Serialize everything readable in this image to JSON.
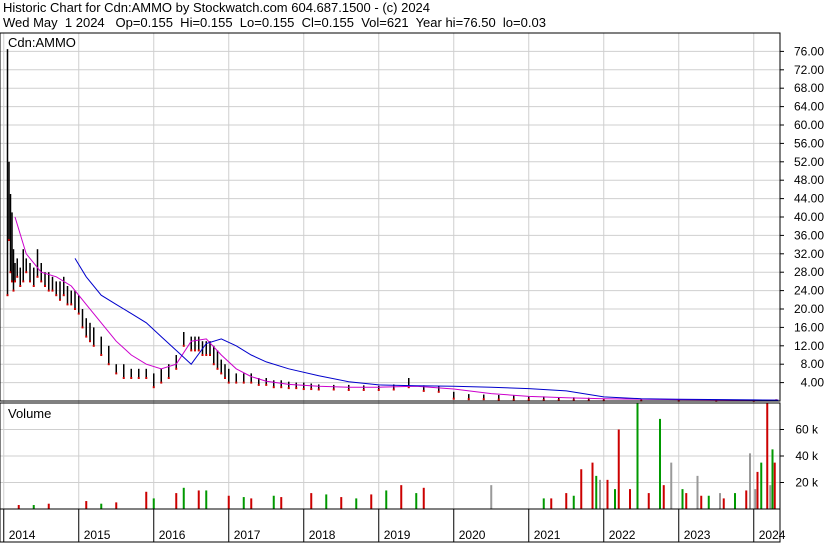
{
  "header": {
    "line1": "Historic Chart for Cdn:AMMO by Stockwatch.com 604.687.1500 - (c) 2024",
    "line2": "Wed May  1 2024   Op=0.155  Hi=0.155  Lo=0.155  Cl=0.155  Vol=621  Year hi=76.50  lo=0.03"
  },
  "chart_data": [
    {
      "type": "line",
      "title": "Cdn:AMMO",
      "ylim": [
        0,
        80
      ],
      "y_ticks": [
        4,
        8,
        12,
        16,
        20,
        24,
        28,
        32,
        36,
        40,
        44,
        48,
        52,
        56,
        60,
        64,
        68,
        72,
        76
      ],
      "y_tick_labels": [
        "4.00",
        "8.00",
        "12.00",
        "16.00",
        "20.00",
        "24.00",
        "28.00",
        "32.00",
        "36.00",
        "40.00",
        "44.00",
        "48.00",
        "52.00",
        "56.00",
        "60.00",
        "64.00",
        "68.00",
        "72.00",
        "76.00"
      ],
      "x_labels": [
        "2014",
        "2015",
        "2016",
        "2017",
        "2018",
        "2019",
        "2020",
        "2021",
        "2022",
        "2023",
        "2024"
      ],
      "x_label_years": [
        2014.0,
        2015.0,
        2016.0,
        2017.0,
        2018.0,
        2019.0,
        2020.0,
        2021.0,
        2022.0,
        2023.0,
        2024.0
      ],
      "grid": true,
      "series": [
        {
          "kind": "price-bars",
          "color": "#000000",
          "x": [
            2014.05,
            2014.07,
            2014.09,
            2014.11,
            2014.13,
            2014.15,
            2014.18,
            2014.22,
            2014.26,
            2014.3,
            2014.35,
            2014.4,
            2014.45,
            2014.5,
            2014.55,
            2014.6,
            2014.65,
            2014.7,
            2014.75,
            2014.8,
            2014.85,
            2014.9,
            2014.95,
            2015.0,
            2015.05,
            2015.1,
            2015.15,
            2015.2,
            2015.3,
            2015.4,
            2015.5,
            2015.6,
            2015.7,
            2015.8,
            2015.9,
            2016.0,
            2016.1,
            2016.2,
            2016.3,
            2016.4,
            2016.5,
            2016.55,
            2016.6,
            2016.65,
            2016.7,
            2016.75,
            2016.8,
            2016.85,
            2016.9,
            2016.95,
            2017.0,
            2017.1,
            2017.2,
            2017.3,
            2017.4,
            2017.5,
            2017.6,
            2017.7,
            2017.8,
            2017.9,
            2018.0,
            2018.1,
            2018.2,
            2018.4,
            2018.6,
            2018.8,
            2019.0,
            2019.2,
            2019.4,
            2019.6,
            2019.8,
            2020.0,
            2020.2,
            2020.4,
            2020.6,
            2020.8,
            2021.0,
            2021.2,
            2021.4,
            2021.6,
            2021.8,
            2022.0,
            2022.5,
            2023.0,
            2023.5,
            2024.0,
            2024.3
          ],
          "high": [
            76.5,
            52,
            45,
            41,
            33,
            30,
            31,
            29,
            33,
            31,
            30,
            29,
            33,
            30,
            28,
            28,
            27,
            26,
            26,
            27,
            25,
            24,
            24,
            23,
            20,
            18,
            17,
            16,
            14,
            12,
            8,
            8,
            7,
            7,
            7,
            6,
            7,
            8,
            10,
            15,
            14,
            14,
            14,
            13,
            13,
            13,
            12,
            11,
            9,
            8,
            7,
            6,
            6,
            6,
            5,
            5,
            4.5,
            4.5,
            4.2,
            4,
            4,
            3.8,
            3.6,
            3.5,
            3.5,
            3.4,
            3.3,
            3.6,
            5,
            3.4,
            3.2,
            2,
            1.5,
            1.4,
            1.3,
            1.2,
            1.0,
            1.0,
            0.8,
            0.8,
            0.7,
            0.5,
            0.4,
            0.3,
            0.25,
            0.2,
            0.155
          ],
          "low": [
            23,
            35,
            28,
            26,
            24,
            26,
            27,
            25,
            26,
            28,
            26,
            25,
            27,
            26,
            25,
            24,
            24,
            23,
            22,
            23,
            21,
            21,
            20,
            19,
            16,
            14,
            13,
            12,
            10,
            8,
            6,
            5,
            5,
            5,
            5,
            3,
            4,
            5,
            7,
            12,
            11,
            11,
            11,
            10,
            10,
            10,
            8,
            7,
            6,
            5,
            4,
            4,
            4,
            4,
            3.5,
            3.5,
            3,
            3,
            2.8,
            2.8,
            2.6,
            2.6,
            2.5,
            2.5,
            2.4,
            2.4,
            2.4,
            2.5,
            3,
            2.2,
            2,
            0.5,
            0.4,
            0.4,
            0.3,
            0.3,
            0.3,
            0.2,
            0.2,
            0.2,
            0.1,
            0.1,
            0.08,
            0.05,
            0.04,
            0.03,
            0.155
          ]
        },
        {
          "kind": "moving-average",
          "color": "#cc00cc",
          "x": [
            2014.15,
            2014.3,
            2014.5,
            2014.7,
            2014.9,
            2015.1,
            2015.3,
            2015.5,
            2015.7,
            2015.9,
            2016.1,
            2016.3,
            2016.5,
            2016.7,
            2016.9,
            2017.1,
            2017.3,
            2017.5,
            2017.8,
            2018.2,
            2018.6,
            2019.0,
            2019.5,
            2020.0,
            2020.5,
            2021.0,
            2021.5,
            2022.0,
            2023.0,
            2024.0,
            2024.33
          ],
          "y": [
            40,
            32,
            28,
            27,
            25,
            21,
            17,
            13,
            10,
            8,
            7,
            8,
            13,
            13.5,
            10,
            7,
            5.3,
            4.3,
            3.6,
            3.2,
            3,
            3,
            3.2,
            2.6,
            1.6,
            1,
            0.7,
            0.5,
            0.3,
            0.2,
            0.16
          ]
        },
        {
          "kind": "moving-average",
          "color": "#0000cc",
          "x": [
            2014.95,
            2015.1,
            2015.3,
            2015.5,
            2015.7,
            2015.9,
            2016.1,
            2016.3,
            2016.5,
            2016.7,
            2016.9,
            2017.1,
            2017.3,
            2017.5,
            2017.8,
            2018.2,
            2018.6,
            2019.0,
            2019.5,
            2020.0,
            2020.5,
            2021.0,
            2021.5,
            2022.0,
            2022.5,
            2023.0,
            2024.0,
            2024.33
          ],
          "y": [
            31,
            27,
            23,
            21,
            19,
            17,
            14,
            11,
            8,
            12.5,
            13.5,
            12,
            10,
            8.5,
            7,
            5.5,
            4.2,
            3.5,
            3.3,
            3.2,
            3.0,
            2.7,
            2.2,
            0.9,
            0.5,
            0.4,
            0.25,
            0.2
          ]
        }
      ]
    },
    {
      "type": "bar",
      "title": "Volume",
      "ylim": [
        0,
        80000
      ],
      "y_ticks": [
        20000,
        40000,
        60000
      ],
      "y_tick_labels": [
        "20 k",
        "40 k",
        "60 k"
      ],
      "series": [
        {
          "name": "",
          "color": "#cc0000",
          "x": [
            2014.2,
            2014.6,
            2015.1,
            2015.5,
            2015.9,
            2016.3,
            2016.6,
            2017.0,
            2017.3,
            2017.7,
            2018.1,
            2018.5,
            2018.9,
            2019.3,
            2019.6,
            2021.3,
            2021.5,
            2021.7,
            2021.85,
            2022.05,
            2022.2,
            2022.35,
            2022.6,
            2022.8,
            2023.1,
            2023.3,
            2023.6,
            2023.9,
            2024.05,
            2024.18,
            2024.28
          ],
          "y": [
            3000,
            4000,
            6000,
            5000,
            13000,
            12000,
            14000,
            10000,
            8000,
            9000,
            12000,
            9000,
            11000,
            18000,
            16000,
            8000,
            12000,
            30000,
            35000,
            22000,
            60000,
            15000,
            12000,
            18000,
            12000,
            10000,
            8000,
            14000,
            28000,
            80000,
            35000
          ]
        },
        {
          "name": "",
          "color": "#009900",
          "x": [
            2014.4,
            2015.3,
            2016.0,
            2016.4,
            2016.7,
            2017.2,
            2017.6,
            2018.3,
            2018.7,
            2019.1,
            2019.5,
            2021.2,
            2021.6,
            2021.9,
            2022.15,
            2022.45,
            2022.75,
            2023.05,
            2023.4,
            2023.75,
            2024.1,
            2024.25
          ],
          "y": [
            3000,
            4000,
            8000,
            16000,
            14000,
            9000,
            10000,
            11000,
            8000,
            14000,
            12000,
            8000,
            10000,
            25000,
            15000,
            80000,
            68000,
            15000,
            10000,
            12000,
            35000,
            45000
          ]
        },
        {
          "name": "",
          "color": "#999999",
          "x": [
            2020.5,
            2021.95,
            2022.9,
            2023.25,
            2023.55,
            2023.95,
            2024.02,
            2024.22
          ],
          "y": [
            18000,
            22000,
            35000,
            25000,
            12000,
            42000,
            15000,
            18000
          ]
        }
      ]
    }
  ]
}
